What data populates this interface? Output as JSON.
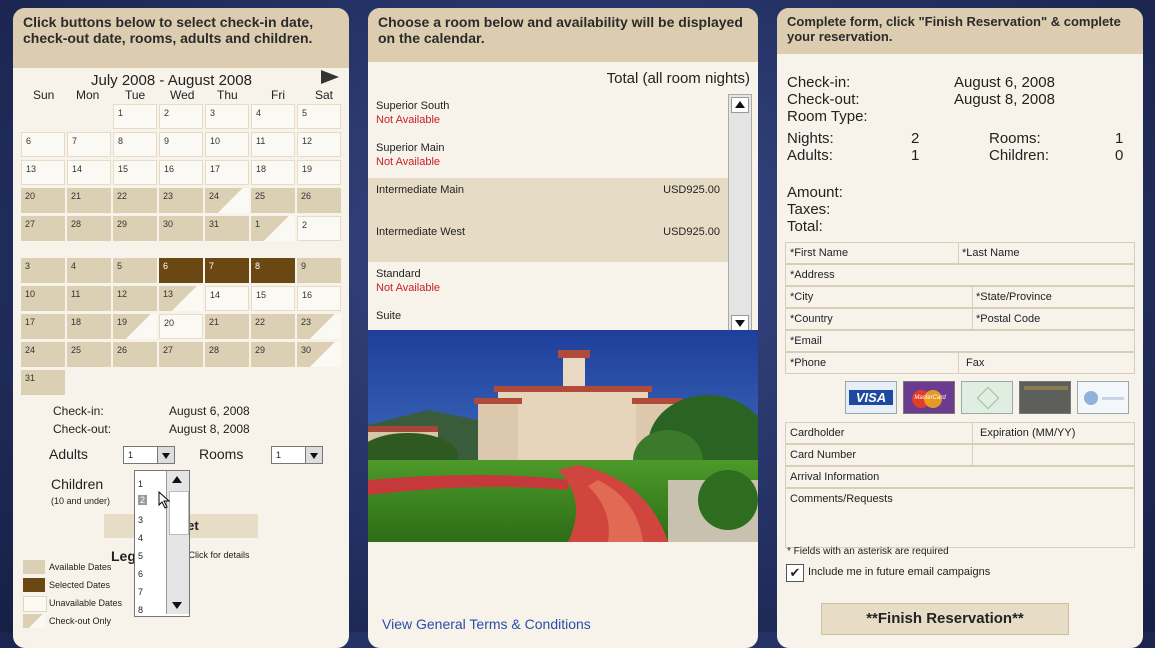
{
  "step1": {
    "header": "Click buttons below to select check-in date, check-out date, rooms, adults and children.",
    "month_title": "July 2008 - August 2008",
    "weekdays": [
      "Sun",
      "Mon",
      "Tue",
      "Wed",
      "Thu",
      "Fri",
      "Sat"
    ],
    "checkin_label": "Check-in:",
    "checkin_value": "August 6, 2008",
    "checkout_label": "Check-out:",
    "checkout_value": "August 8, 2008",
    "adults_label": "Adults",
    "adults_value": "1",
    "rooms_label": "Rooms",
    "rooms_value": "1",
    "children_label": "Children",
    "children_note": "(10 and under)",
    "dropdown_options": [
      "1",
      "2",
      "3",
      "4",
      "5",
      "6",
      "7",
      "8"
    ],
    "reset_label": "Reset",
    "legend_title": "Legend",
    "legend_hint": "- Click for details",
    "legend_items": [
      "Available Dates",
      "Selected Dates",
      "Unavailable Dates",
      "Check-out Only"
    ]
  },
  "step2": {
    "header": "Choose a room below and availability will be displayed on the calendar.",
    "total_label": "Total (all room nights)",
    "rooms": [
      {
        "name": "Superior South",
        "status": "Not Available",
        "price": ""
      },
      {
        "name": "Superior Main",
        "status": "Not Available",
        "price": ""
      },
      {
        "name": "Intermediate Main",
        "status": "",
        "price": "USD925.00"
      },
      {
        "name": "Intermediate West",
        "status": "",
        "price": "USD925.00"
      },
      {
        "name": "Standard",
        "status": "Not Available",
        "price": ""
      },
      {
        "name": "Suite",
        "status": "",
        "price": ""
      }
    ],
    "terms_link": "View General Terms & Conditions"
  },
  "step3": {
    "header": "Complete form, click \"Finish Reservation\" & complete your reservation.",
    "checkin_label": "Check-in:",
    "checkin_value": "August 6, 2008",
    "checkout_label": "Check-out:",
    "checkout_value": "August 8, 2008",
    "room_type_label": "Room Type:",
    "nights_label": "Nights:",
    "nights_value": "2",
    "rooms_label": "Rooms:",
    "rooms_value": "1",
    "adults_label": "Adults:",
    "adults_value": "1",
    "children_label": "Children:",
    "children_value": "0",
    "amount_label": "Amount:",
    "taxes_label": "Taxes:",
    "total_label": "Total:",
    "fields": {
      "first_name": "*First Name",
      "last_name": "*Last Name",
      "address": "*Address",
      "city": "*City",
      "state": "*State/Province",
      "country": "*Country",
      "postal": "*Postal Code",
      "email": "*Email",
      "phone": "*Phone",
      "fax": "Fax",
      "cardholder": "Cardholder",
      "expiration": "Expiration (MM/YY)",
      "card_number": "Card Number",
      "arrival": "Arrival Information",
      "comments": "Comments/Requests"
    },
    "card_visa": "VISA",
    "card_mc": "MasterCard",
    "required_note": "* Fields with an asterisk are required",
    "email_opt_in": "Include me in future email campaigns",
    "finish_label": "**Finish Reservation**"
  },
  "colors": {
    "available": "#dbcfb4",
    "selected": "#6b4714",
    "unavailable": "#fbf9f3",
    "not_available_text": "#c8202a",
    "link": "#2a4fa8"
  }
}
